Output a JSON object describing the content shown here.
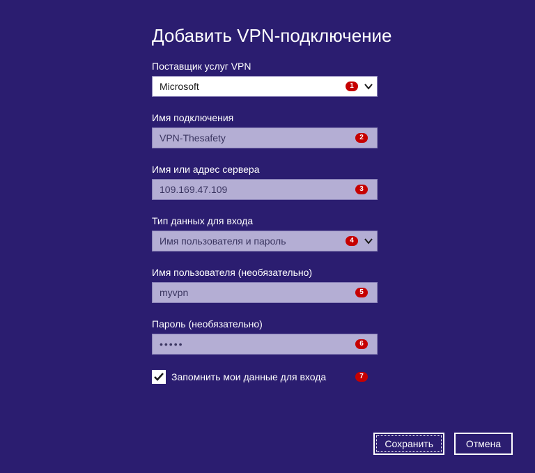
{
  "title": "Добавить VPN-подключение",
  "fields": {
    "provider": {
      "label": "Поставщик услуг VPN",
      "value": "Microsoft",
      "badge": "1"
    },
    "connection_name": {
      "label": "Имя подключения",
      "value": "VPN-Thesafety",
      "badge": "2"
    },
    "server": {
      "label": "Имя или адрес сервера",
      "value": "109.169.47.109",
      "badge": "3"
    },
    "signin_type": {
      "label": "Тип данных для входа",
      "value": "Имя пользователя и пароль",
      "badge": "4"
    },
    "username": {
      "label": "Имя пользователя (необязательно)",
      "value": "myvpn",
      "badge": "5"
    },
    "password": {
      "label": "Пароль (необязательно)",
      "value": "•••••",
      "badge": "6"
    },
    "remember": {
      "label": "Запомнить мои данные для входа",
      "checked": true,
      "badge": "7"
    }
  },
  "buttons": {
    "save": "Сохранить",
    "cancel": "Отмена"
  }
}
